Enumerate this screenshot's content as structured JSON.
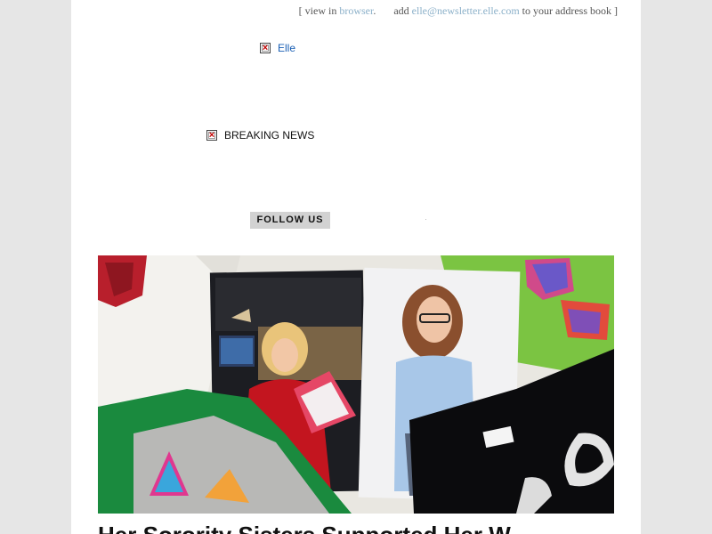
{
  "header": {
    "view_prefix": "[ view in",
    "view_link": "browser",
    "view_suffix": ".",
    "add_prefix": "add",
    "email_link": "elle@newsletter.elle.com",
    "add_suffix": "to your address book ]"
  },
  "logo": {
    "alt": "Elle"
  },
  "breaking": {
    "alt": "BREAKING NEWS"
  },
  "social": {
    "follow_label": "FOLLOW US"
  },
  "hero": {
    "description": "collage of two young women and Greek-letter t-shirts"
  },
  "article": {
    "headline": "Her Sorority Sisters Supported Her W"
  },
  "colors": {
    "page_bg": "#e6e6e6",
    "link": "#8bb0c9",
    "alt_link": "#1a5fb4",
    "follow_bg": "#d2d2d2"
  }
}
